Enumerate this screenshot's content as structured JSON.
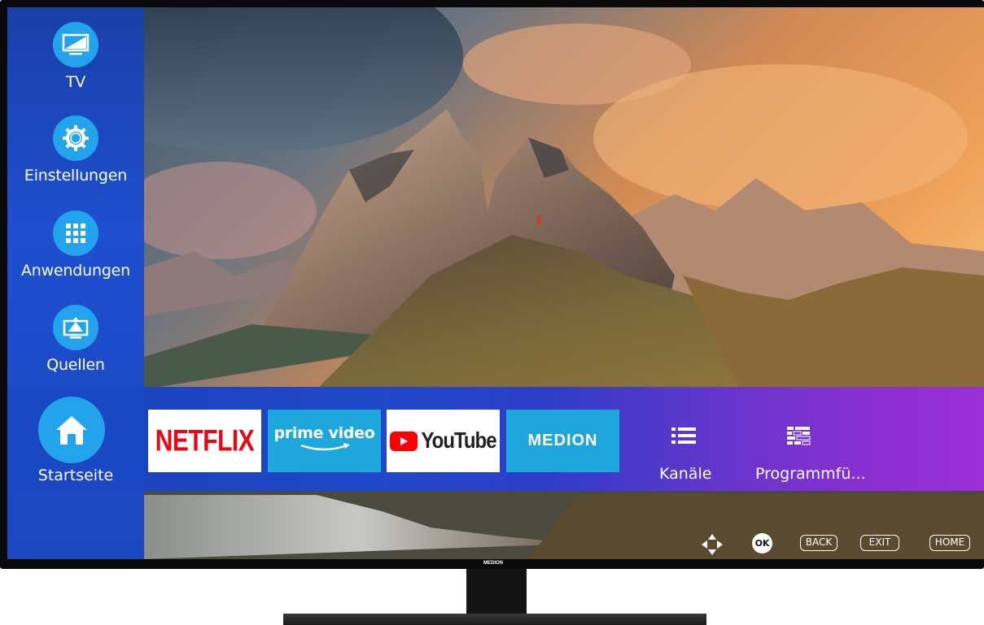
{
  "tv": {
    "brand": "MEDION"
  },
  "side_nav": {
    "items": [
      {
        "label": "TV",
        "icon": "tv-icon"
      },
      {
        "label": "Einstellungen",
        "icon": "gear-icon"
      },
      {
        "label": "Anwendungen",
        "icon": "apps-grid-icon"
      },
      {
        "label": "Quellen",
        "icon": "sources-icon"
      }
    ],
    "home": {
      "label": "Startseite",
      "icon": "home-icon"
    }
  },
  "apps": [
    {
      "label": "NETFLIX",
      "color": "#e50914"
    },
    {
      "label": "prime video",
      "color": "#1fa6da"
    },
    {
      "label": "YouTube",
      "color": "#ff0000"
    },
    {
      "label": "MEDION",
      "color": "#1fa6da"
    }
  ],
  "functions": [
    {
      "label": "Kanäle",
      "icon": "list-icon"
    },
    {
      "label": "Programmfü...",
      "icon": "epg-grid-icon"
    }
  ],
  "key_hints": {
    "nav": "dpad-icon",
    "ok": "OK",
    "back": "BACK",
    "exit": "EXIT",
    "home": "HOME"
  },
  "colors": {
    "accent": "#22a3ec",
    "nav_bg": "#1e4fd0",
    "bar_end": "#9a30d6"
  }
}
